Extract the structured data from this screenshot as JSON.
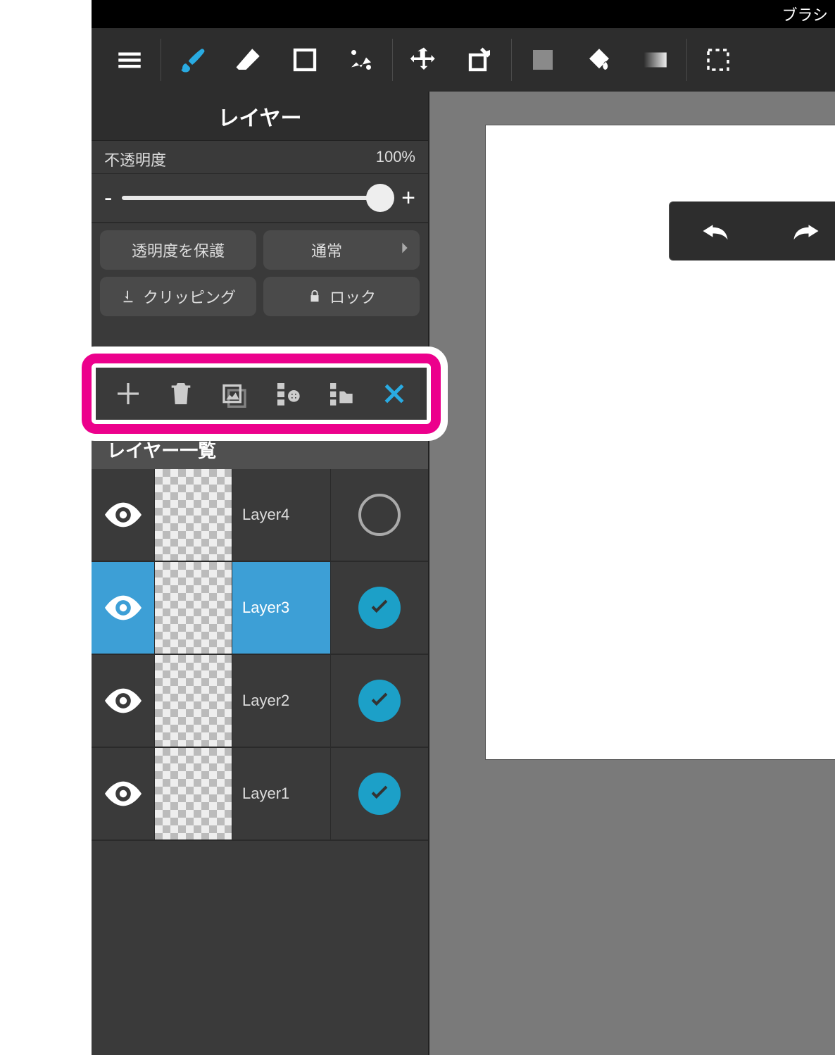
{
  "titlebar": {
    "text": "ブラシ"
  },
  "panel": {
    "title": "レイヤー",
    "opacity_label": "不透明度",
    "opacity_value": "100%",
    "minus": "-",
    "plus": "+",
    "protect_alpha": "透明度を保護",
    "blend_mode": "通常",
    "clipping": "クリッピング",
    "lock": "ロック",
    "list_header": "レイヤー一覧"
  },
  "toolbar": {
    "items": [
      "menu",
      "brush",
      "eraser",
      "shape",
      "smudge",
      "move",
      "transform",
      "foreground",
      "bucket",
      "gradient",
      "select"
    ]
  },
  "action_bar": {
    "items": [
      "add",
      "delete",
      "image",
      "merge-down",
      "merge-folder",
      "close"
    ]
  },
  "layers": [
    {
      "name": "Layer4",
      "visible": true,
      "selected": false,
      "checked": false
    },
    {
      "name": "Layer3",
      "visible": true,
      "selected": true,
      "checked": true
    },
    {
      "name": "Layer2",
      "visible": true,
      "selected": false,
      "checked": true
    },
    {
      "name": "Layer1",
      "visible": true,
      "selected": false,
      "checked": true
    }
  ],
  "undo_redo": {
    "undo": "undo",
    "redo": "redo"
  }
}
